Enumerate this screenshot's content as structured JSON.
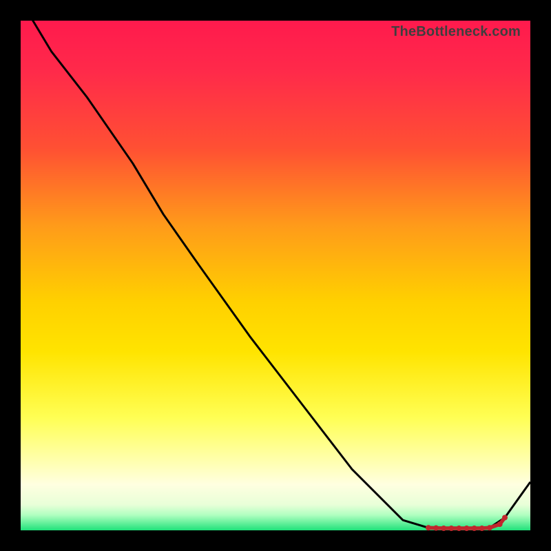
{
  "watermark": "TheBottleneck.com",
  "chart_data": {
    "type": "line",
    "title": "",
    "xlabel": "",
    "ylabel": "",
    "xlim": [
      0,
      100
    ],
    "ylim": [
      0,
      100
    ],
    "series": [
      {
        "name": "curve",
        "x": [
          0,
          6,
          13,
          22,
          28,
          35,
          45,
          55,
          65,
          75,
          80,
          83,
          86,
          89,
          92,
          95,
          100
        ],
        "values": [
          104,
          94,
          85,
          72,
          62,
          52,
          38,
          25,
          12,
          2,
          0.5,
          0.4,
          0.4,
          0.4,
          0.5,
          2.5,
          9.5
        ],
        "color": "#000000",
        "stroke_width": 3
      },
      {
        "name": "highlight_dots",
        "x": [
          80,
          81.5,
          83,
          84.5,
          86,
          87.5,
          89,
          90.5,
          92,
          94,
          95
        ],
        "values": [
          0.5,
          0.45,
          0.4,
          0.4,
          0.4,
          0.4,
          0.4,
          0.4,
          0.5,
          1.2,
          2.5
        ],
        "color": "#c1272d",
        "marker_radius": 4
      }
    ]
  }
}
